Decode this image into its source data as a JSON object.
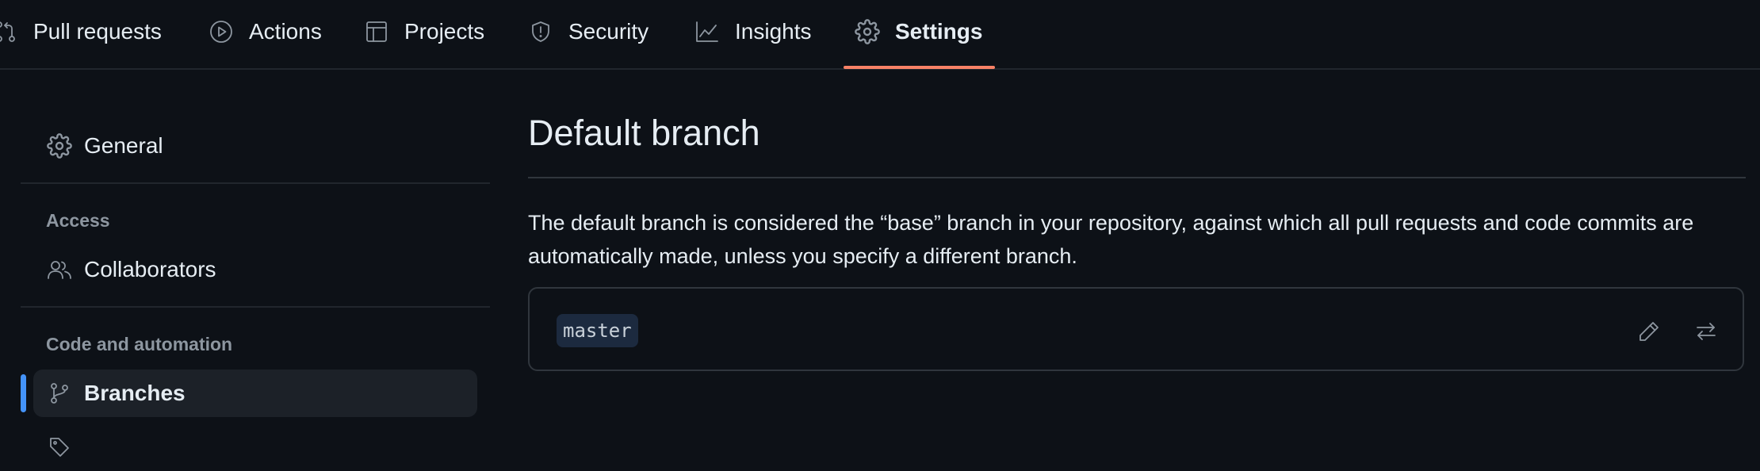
{
  "repo_nav": {
    "tabs": [
      {
        "label": "Pull requests",
        "icon": "git-pull-request-icon"
      },
      {
        "label": "Actions",
        "icon": "play-icon"
      },
      {
        "label": "Projects",
        "icon": "table-icon"
      },
      {
        "label": "Security",
        "icon": "shield-icon"
      },
      {
        "label": "Insights",
        "icon": "graph-icon"
      },
      {
        "label": "Settings",
        "icon": "gear-icon",
        "active": true
      }
    ],
    "accent_color": "#f78166"
  },
  "sidebar": {
    "general_label": "General",
    "access_heading": "Access",
    "collaborators_label": "Collaborators",
    "code_heading": "Code and automation",
    "branches_label": "Branches",
    "active_item": "Branches",
    "active_indicator_color": "#4493f8"
  },
  "main": {
    "title": "Default branch",
    "description": "The default branch is considered the “base” branch in your repository, against which all pull requests and code commits are automatically made, unless you specify a different branch.",
    "default_branch": "master",
    "edit_icon": "pencil-icon",
    "switch_icon": "arrow-switch-icon"
  }
}
